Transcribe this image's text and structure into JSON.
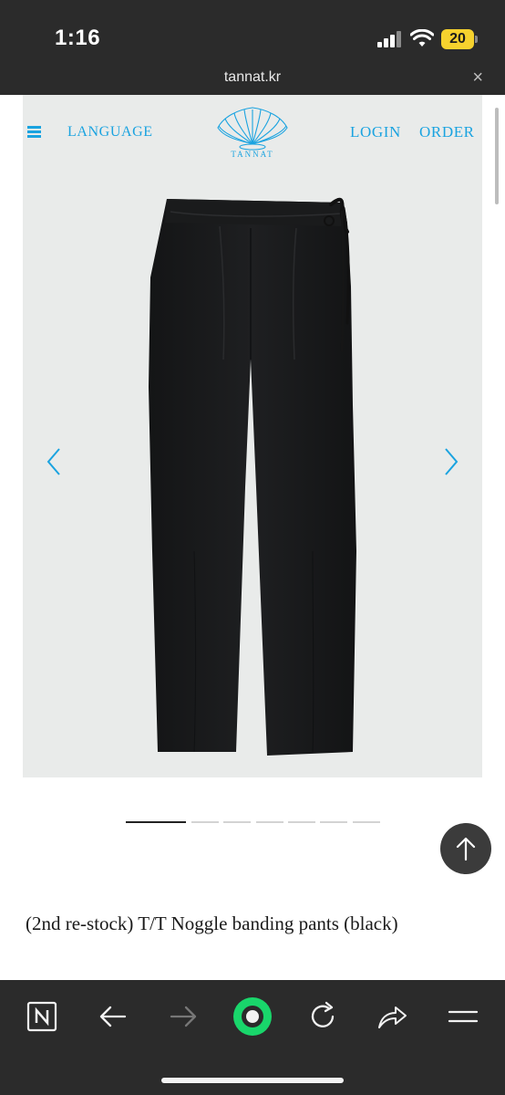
{
  "status_bar": {
    "time": "1:16",
    "battery_level": "20",
    "icons": [
      "cellular-signal-icon",
      "wifi-icon",
      "battery-icon"
    ]
  },
  "browser": {
    "url": "tannat.kr",
    "close_icon": "×"
  },
  "site_header": {
    "language_label": "LANGUAGE",
    "logo_text": "TANNAT",
    "login_label": "LOGIN",
    "order_label": "ORDER",
    "accent_color": "#1aa3e0"
  },
  "gallery": {
    "image_count": 7,
    "active_index": 0,
    "prev_icon": "chevron-left-icon",
    "next_icon": "chevron-right-icon"
  },
  "product": {
    "title": "(2nd re-stock) T/T Noggle banding pants (black)"
  },
  "toolbar": {
    "items": [
      "naver-home-icon",
      "back-arrow-icon",
      "forward-arrow-icon",
      "green-dot-icon",
      "refresh-icon",
      "share-icon",
      "menu-icon"
    ],
    "accent_color": "#19d66b"
  }
}
